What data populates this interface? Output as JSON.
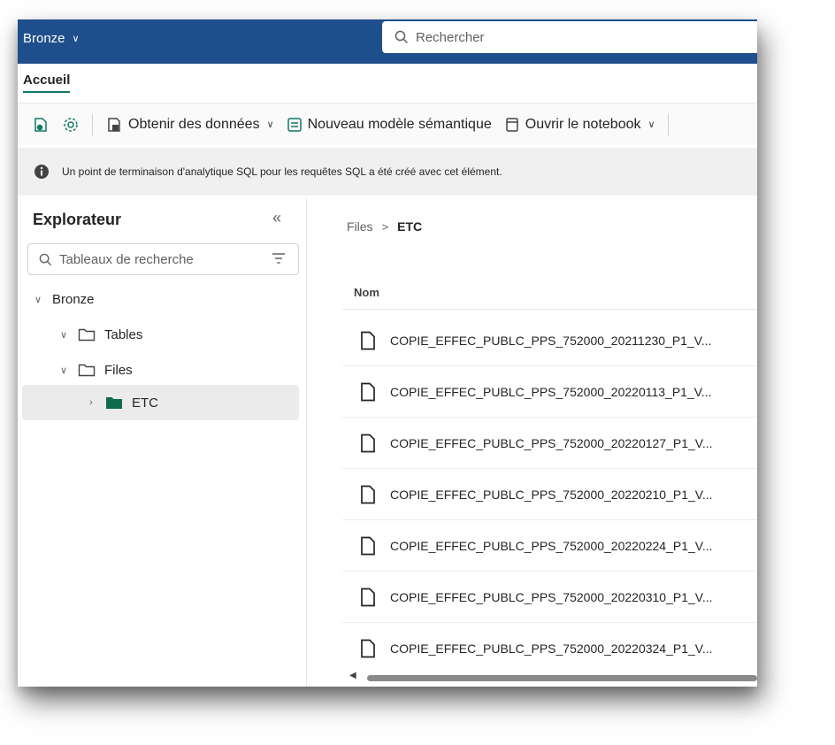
{
  "colors": {
    "topbar": "#1f4e8c",
    "accent": "#117865",
    "folder_fill": "#0e6b4e"
  },
  "topbar": {
    "workspace": "Bronze",
    "search_placeholder": "Rechercher"
  },
  "tabs": [
    {
      "label": "Accueil",
      "active": true
    }
  ],
  "ribbon": {
    "get_data": "Obtenir des données",
    "new_model": "Nouveau modèle sémantique",
    "open_notebook": "Ouvrir le notebook"
  },
  "banner": {
    "text": "Un point de terminaison d'analytique SQL pour les requêtes SQL a été créé avec cet élément."
  },
  "explorer": {
    "title": "Explorateur",
    "search_placeholder": "Tableaux de recherche",
    "tree": [
      {
        "label": "Bronze",
        "icon": "chevron-down-icon"
      },
      {
        "label": "Tables",
        "icon": "folder-outline-icon"
      },
      {
        "label": "Files",
        "icon": "folder-outline-icon"
      },
      {
        "label": "ETC",
        "icon": "folder-filled-icon",
        "selected": true
      }
    ]
  },
  "main": {
    "breadcrumb": {
      "root": "Files",
      "current": "ETC"
    },
    "column_name": "Nom",
    "files": [
      "COPIE_EFFEC_PUBLC_PPS_752000_20211230_P1_V...",
      "COPIE_EFFEC_PUBLC_PPS_752000_20220113_P1_V...",
      "COPIE_EFFEC_PUBLC_PPS_752000_20220127_P1_V...",
      "COPIE_EFFEC_PUBLC_PPS_752000_20220210_P1_V...",
      "COPIE_EFFEC_PUBLC_PPS_752000_20220224_P1_V...",
      "COPIE_EFFEC_PUBLC_PPS_752000_20220310_P1_V...",
      "COPIE_EFFEC_PUBLC_PPS_752000_20220324_P1_V..."
    ]
  }
}
